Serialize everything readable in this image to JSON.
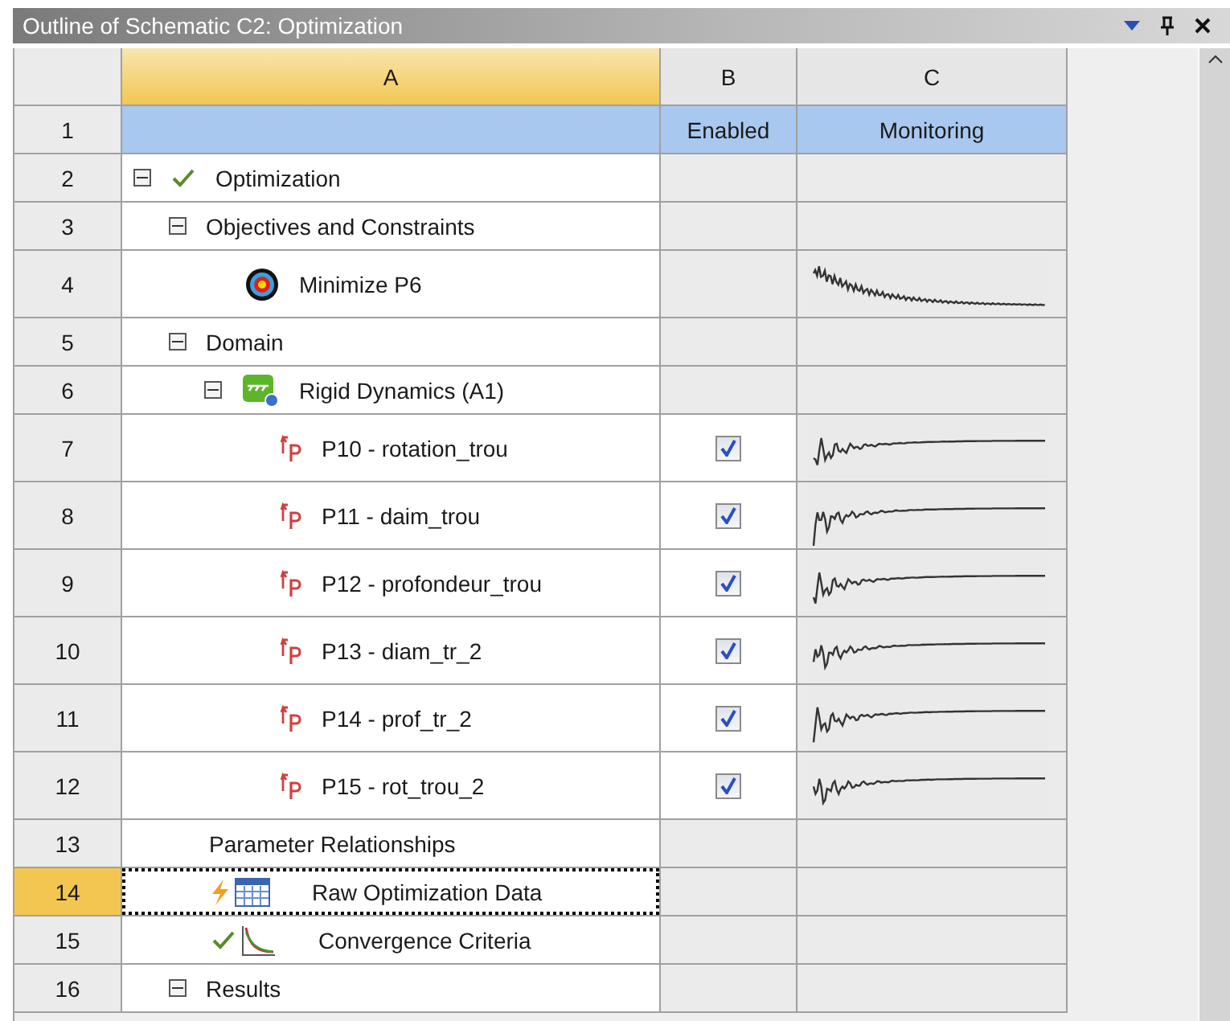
{
  "panel": {
    "title": "Outline of Schematic C2: Optimization"
  },
  "columns": [
    "A",
    "B",
    "C"
  ],
  "header_row": {
    "number": "1",
    "enabled": "Enabled",
    "monitoring": "Monitoring"
  },
  "rows": [
    {
      "number": "2",
      "label": "Optimization",
      "kind": "check",
      "expanded": true,
      "selected": false,
      "children": [
        {
          "number": "3",
          "label": "Objectives and Constraints",
          "expanded": true,
          "selected": false,
          "children": [
            {
              "number": "4",
              "label": "Minimize P6",
              "kind": "target",
              "selected": false,
              "monitoring": true
            }
          ]
        },
        {
          "number": "5",
          "label": "Domain",
          "expanded": true,
          "selected": false,
          "children": [
            {
              "number": "6",
              "label": "Rigid Dynamics (A1)",
              "kind": "system",
              "expanded": true,
              "selected": false,
              "children": [
                {
                  "number": "7",
                  "label": "P10 - rotation_trou",
                  "kind": "parameter",
                  "selected": false,
                  "enabled": true,
                  "monitoring": true
                },
                {
                  "number": "8",
                  "label": "P11 - daim_trou",
                  "kind": "parameter",
                  "selected": false,
                  "enabled": true,
                  "monitoring": true
                },
                {
                  "number": "9",
                  "label": "P12 - profondeur_trou",
                  "kind": "parameter",
                  "selected": false,
                  "enabled": true,
                  "monitoring": true
                },
                {
                  "number": "10",
                  "label": "P13 - diam_tr_2",
                  "kind": "parameter",
                  "selected": false,
                  "enabled": true,
                  "monitoring": true
                },
                {
                  "number": "11",
                  "label": "P14 - prof_tr_2",
                  "kind": "parameter",
                  "selected": false,
                  "enabled": true,
                  "monitoring": true
                },
                {
                  "number": "12",
                  "label": "P15 - rot_trou_2",
                  "kind": "parameter",
                  "selected": false,
                  "enabled": true,
                  "monitoring": true
                }
              ]
            }
          ]
        },
        {
          "number": "13",
          "label": "Parameter Relationships",
          "selected": false
        },
        {
          "number": "14",
          "label": "Raw Optimization Data",
          "kind": "table",
          "selected": true
        },
        {
          "number": "15",
          "label": "Convergence Criteria",
          "kind": "chart",
          "selected": false
        },
        {
          "number": "16",
          "label": "Results",
          "expanded": true,
          "selected": false
        }
      ]
    }
  ]
}
